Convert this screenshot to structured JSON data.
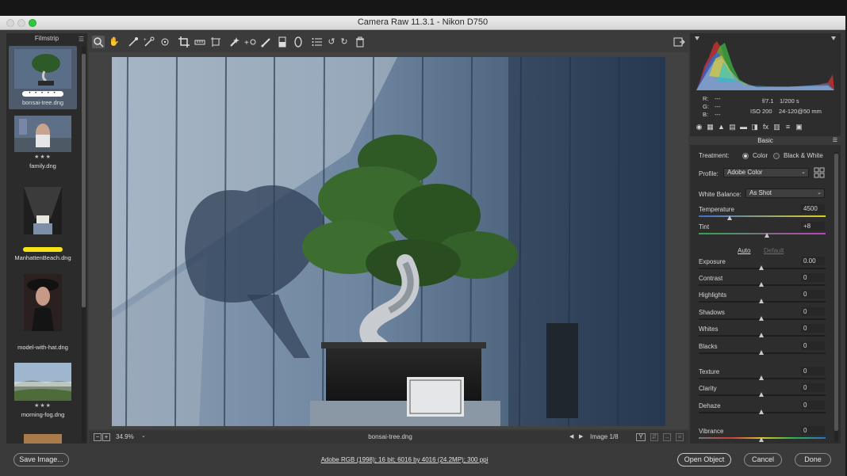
{
  "window": {
    "title": "Camera Raw 11.3.1  -  Nikon D750"
  },
  "filmstrip": {
    "title": "Filmstrip",
    "items": [
      {
        "name": "bonsai-tree.dng",
        "stars": "",
        "selected": true,
        "rating_dots": "• • • • •"
      },
      {
        "name": "family.dng",
        "stars": "★★★"
      },
      {
        "name": "ManhattenBeach.dng",
        "stars": ""
      },
      {
        "name": "model-with-hat.dng",
        "stars": ""
      },
      {
        "name": "morning-fog.dng",
        "stars": "★★★"
      }
    ]
  },
  "statusbar": {
    "zoom": "34.9%",
    "filename": "bonsai-tree.dng",
    "image_counter": "Image 1/8",
    "compare_label": "Y"
  },
  "info": {
    "r_label": "R:",
    "r_value": "---",
    "g_label": "G:",
    "g_value": "---",
    "b_label": "B:",
    "b_value": "---",
    "aperture": "f/7.1",
    "shutter": "1/200 s",
    "iso": "ISO 200",
    "lens": "24-120@50 mm"
  },
  "basic": {
    "title": "Basic",
    "treatment_label": "Treatment:",
    "treatment_color": "Color",
    "treatment_bw": "Black & White",
    "profile_label": "Profile:",
    "profile_value": "Adobe Color",
    "wb_label": "White Balance:",
    "wb_value": "As Shot",
    "auto_label": "Auto",
    "default_label": "Default",
    "sliders": [
      {
        "label": "Temperature",
        "value": "4500",
        "pos": 0.25
      },
      {
        "label": "Tint",
        "value": "+8",
        "pos": 0.54
      },
      {
        "label": "Exposure",
        "value": "0.00",
        "pos": 0.5
      },
      {
        "label": "Contrast",
        "value": "0",
        "pos": 0.5
      },
      {
        "label": "Highlights",
        "value": "0",
        "pos": 0.5
      },
      {
        "label": "Shadows",
        "value": "0",
        "pos": 0.5
      },
      {
        "label": "Whites",
        "value": "0",
        "pos": 0.5
      },
      {
        "label": "Blacks",
        "value": "0",
        "pos": 0.5
      },
      {
        "label": "Texture",
        "value": "0",
        "pos": 0.5
      },
      {
        "label": "Clarity",
        "value": "0",
        "pos": 0.5
      },
      {
        "label": "Dehaze",
        "value": "0",
        "pos": 0.5
      },
      {
        "label": "Vibrance",
        "value": "0",
        "pos": 0.5
      }
    ]
  },
  "bottom": {
    "save_image": "Save Image...",
    "workflow_link": "Adobe RGB (1998); 16 bit; 6016 by 4016 (24.2MP); 300 ppi",
    "open_object": "Open Object",
    "cancel": "Cancel",
    "done": "Done"
  },
  "toolbar": {
    "icons": [
      "zoom-icon",
      "hand-icon",
      "white-balance-icon",
      "color-sampler-icon",
      "targeted-adjustment-icon",
      "crop-icon",
      "straighten-icon",
      "transform-icon",
      "spot-removal-icon",
      "red-eye-icon",
      "adjustment-brush-icon",
      "graduated-filter-icon",
      "radial-filter-icon",
      "presets-list-icon",
      "rotate-left-icon",
      "rotate-right-icon",
      "trash-icon"
    ]
  },
  "colors": {
    "accent": "#4e5b6c",
    "temperature_low": "#3b6fd6",
    "temperature_high": "#e0d020",
    "tint_low": "#2ea84b",
    "tint_high": "#c23fb8"
  }
}
